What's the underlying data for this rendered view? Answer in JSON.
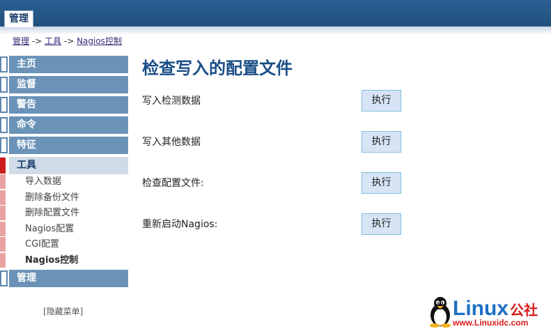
{
  "header": {
    "tab_label": "管理"
  },
  "breadcrumb": {
    "part1": "管理",
    "sep1": " -> ",
    "part2": "工具",
    "sep2": " -> ",
    "part3": "Nagios控制"
  },
  "nav": {
    "items": [
      {
        "label": "主页"
      },
      {
        "label": "监督"
      },
      {
        "label": "警告"
      },
      {
        "label": "命令"
      },
      {
        "label": "特征"
      },
      {
        "label": "工具"
      },
      {
        "label": "管理"
      }
    ],
    "tools_sub": [
      {
        "label": "导入数据"
      },
      {
        "label": "删除备份文件"
      },
      {
        "label": "删除配置文件"
      },
      {
        "label": "Nagios配置"
      },
      {
        "label": "CGI配置"
      },
      {
        "label": "Nagios控制"
      }
    ],
    "hide_menu": "[隐藏菜单]"
  },
  "main": {
    "title": "检查写入的配置文件",
    "rows": [
      {
        "label": "写入检测数据",
        "button": "执行"
      },
      {
        "label": "写入其他数据",
        "button": "执行"
      },
      {
        "label": "检查配置文件:",
        "button": "执行"
      },
      {
        "label": "重新启动Nagios:",
        "button": "执行"
      }
    ]
  },
  "logo": {
    "brand": "Linux",
    "suffix": "公社",
    "url": "www.Linuxidc.com"
  },
  "colors": {
    "header_blue": "#1f4d7a",
    "nav_blue": "#6b93b8",
    "active_red": "#cc1d1d",
    "title_blue": "#1a4d86"
  }
}
